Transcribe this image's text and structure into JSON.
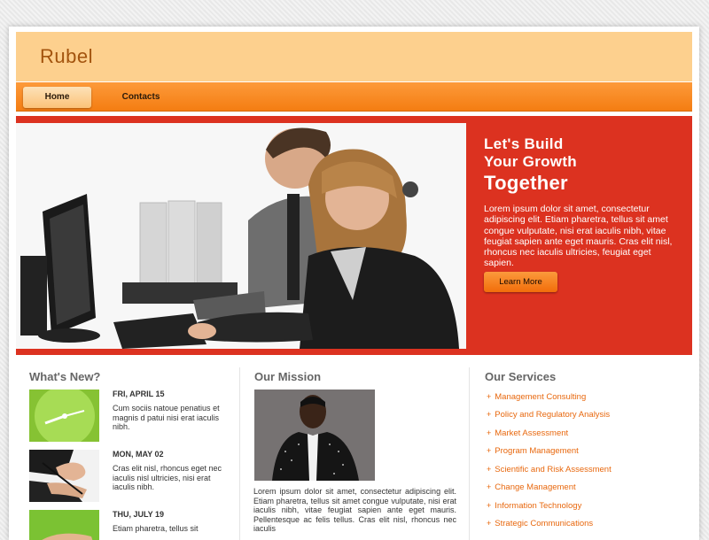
{
  "header": {
    "logo": "Rubel"
  },
  "nav": {
    "items": [
      {
        "label": "Home"
      },
      {
        "label": "Contacts"
      }
    ]
  },
  "hero": {
    "title_line1": "Let's Build",
    "title_line2": "Your Growth",
    "title_line3": "Together",
    "text": "Lorem ipsum dolor sit amet, consectetur adipiscing elit. Etiam pharetra, tellus sit amet congue vulputate, nisi erat iaculis nibh, vitae feugiat sapien ante eget mauris. Cras elit nisl, rhoncus nec iaculis ultricies, feugiat eget sapien.",
    "button": "Learn More"
  },
  "whats_new": {
    "title": "What's New?",
    "items": [
      {
        "date": "FRI, APRIL 15",
        "text": "Cum sociis natoue penatius et magnis d patui nisi erat iaculis nibh."
      },
      {
        "date": "MON, MAY 02",
        "text": "Cras elit nisl, rhoncus eget nec iaculis nisl ultricies, nisi erat iaculis nibh."
      },
      {
        "date": "THU, JULY 19",
        "text": "Etiam pharetra, tellus sit"
      }
    ]
  },
  "mission": {
    "title": "Our Mission",
    "text": "Lorem ipsum dolor sit amet, consectetur adipiscing elit. Etiam pharetra, tellus sit amet congue vulputate, nisi erat iaculis nibh, vitae feugiat sapien ante eget mauris. Pellentesque ac felis tellus. Cras elit nisl, rhoncus nec iaculis"
  },
  "services": {
    "title": "Our Services",
    "items": [
      "Management Consulting",
      "Policy and Regulatory Analysis",
      "Market Assessment",
      "Program Management",
      "Scientific and Risk Assessment",
      "Change Management",
      "Information Technology",
      "Strategic Communications"
    ]
  },
  "colors": {
    "header_bg": "#fdd08e",
    "nav_bg": "#f47d12",
    "hero_bg": "#dc3220",
    "link": "#e8680e"
  }
}
